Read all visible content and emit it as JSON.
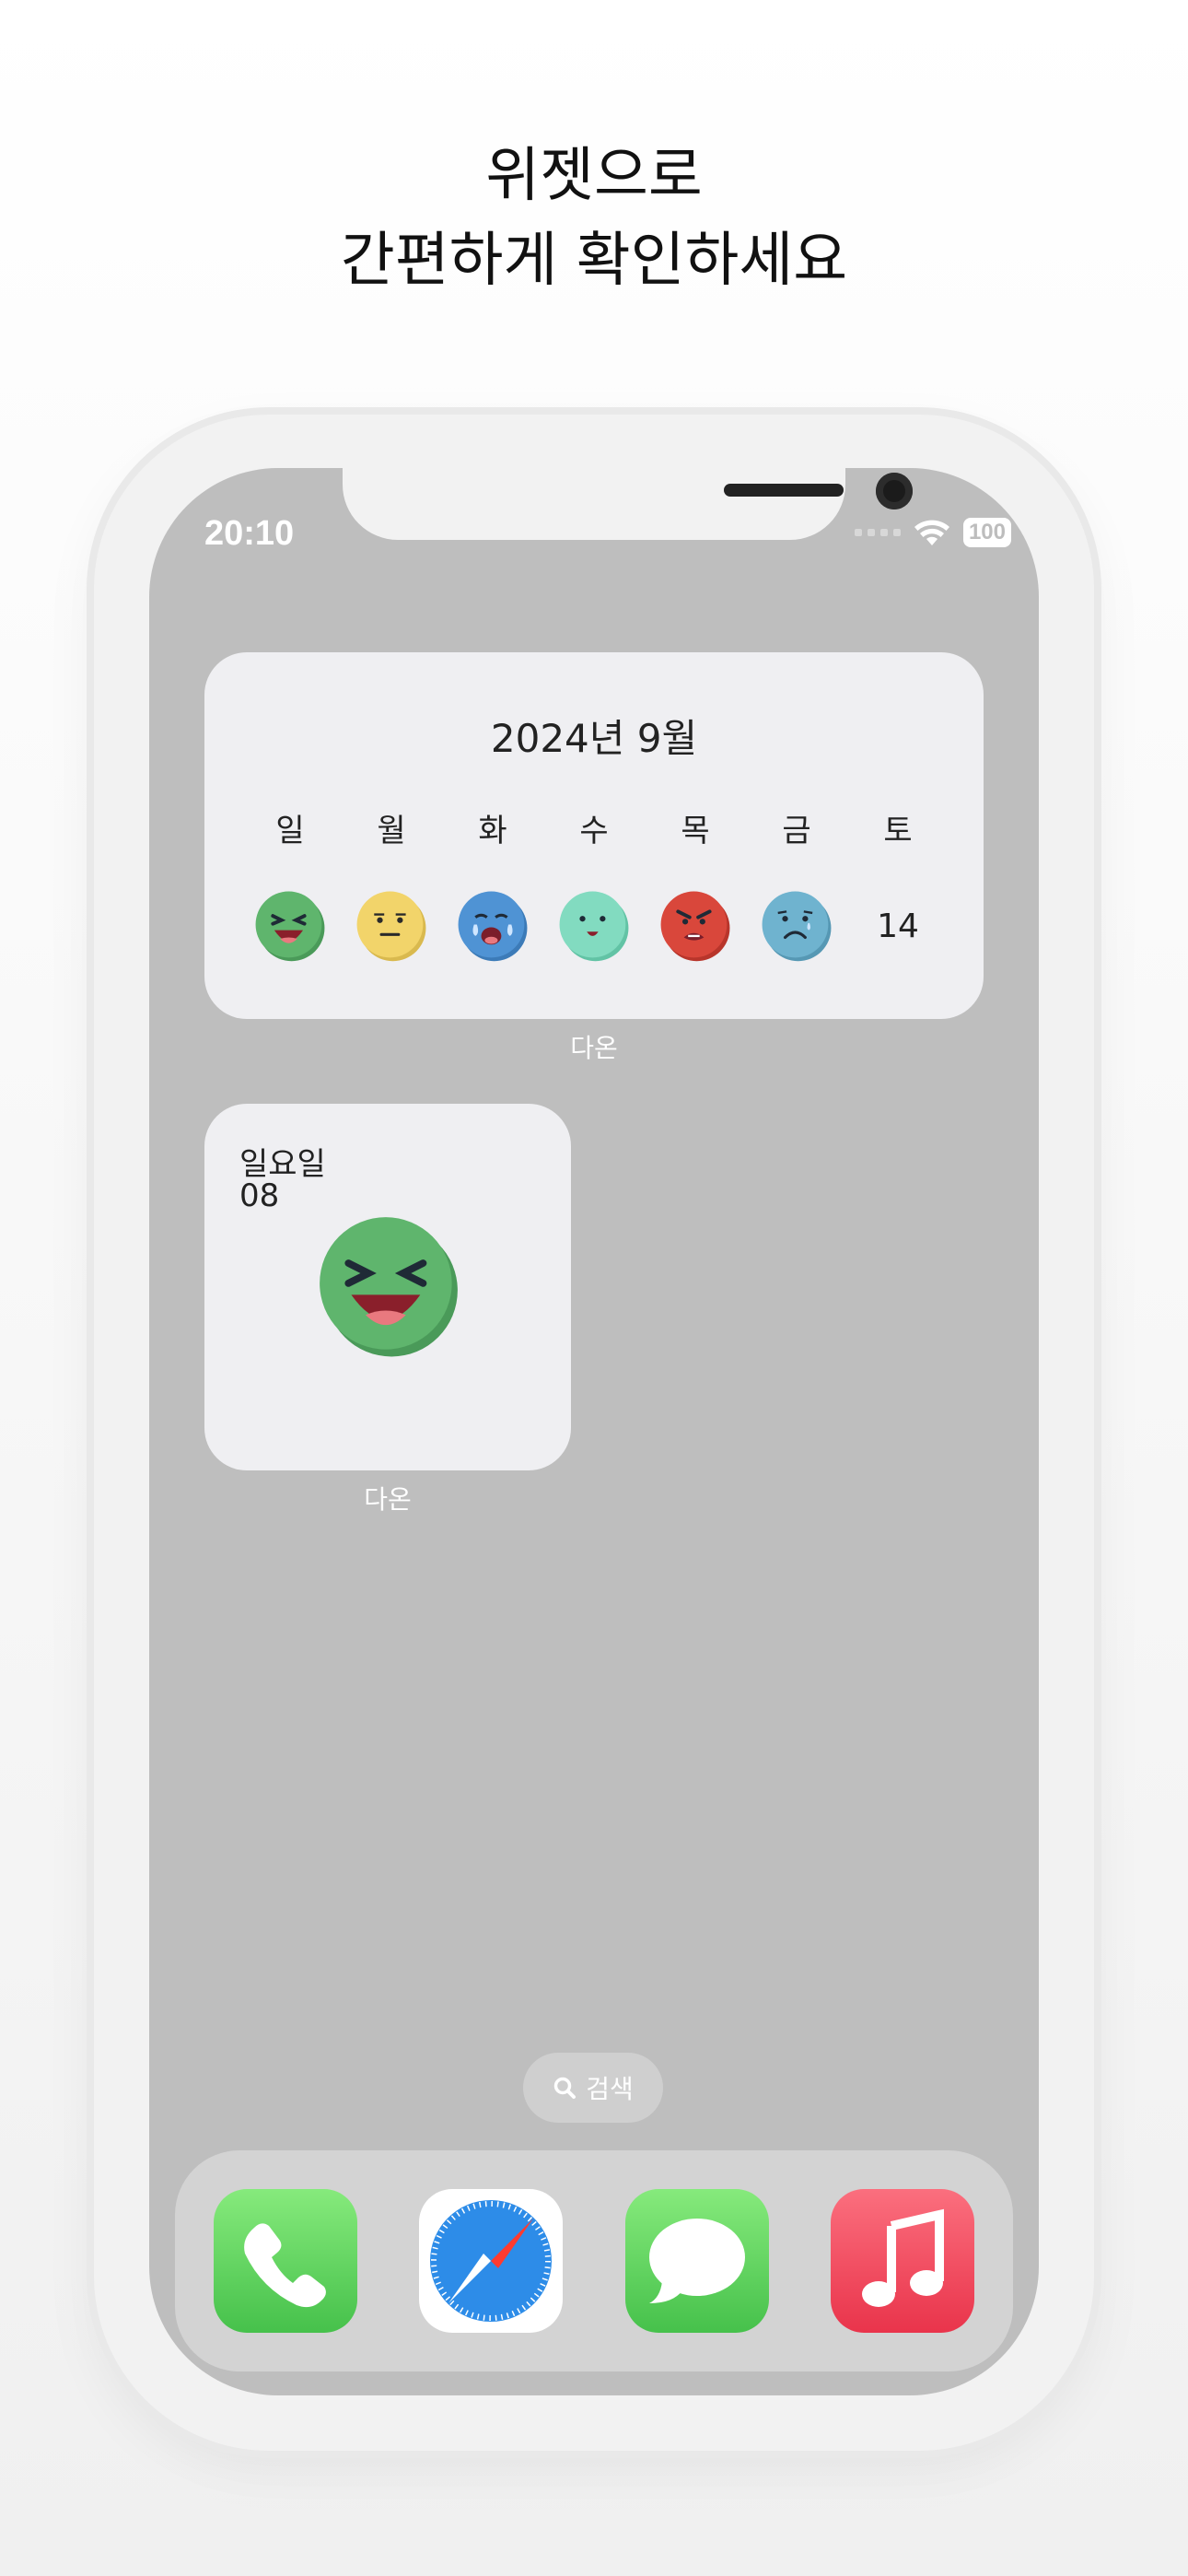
{
  "headline": {
    "line1": "위젯으로",
    "line2": "간편하게 확인하세요"
  },
  "status_bar": {
    "time": "20:10",
    "battery": "100"
  },
  "calendar_widget": {
    "title": "2024년 9월",
    "weekdays": [
      "일",
      "월",
      "화",
      "수",
      "목",
      "금",
      "토"
    ],
    "days": [
      {
        "mood": "laughing-green"
      },
      {
        "mood": "neutral-yellow"
      },
      {
        "mood": "crying-blue"
      },
      {
        "mood": "smiling-mint"
      },
      {
        "mood": "angry-red"
      },
      {
        "mood": "sad-teal"
      },
      {
        "number": "14"
      }
    ],
    "label": "다온"
  },
  "day_widget": {
    "day_name": "일요일",
    "day_number": "08",
    "mood": "laughing-green",
    "label": "다온"
  },
  "search": {
    "label": "검색",
    "icon": "search-icon"
  },
  "dock": {
    "apps": [
      "Phone",
      "Safari",
      "Messages",
      "Music"
    ]
  },
  "colors": {
    "green": "#5fb56d",
    "yellow": "#f2d46a",
    "blue": "#4f93d4",
    "mint": "#82dbc0",
    "red": "#d9473b",
    "teal": "#6fb3cf"
  }
}
